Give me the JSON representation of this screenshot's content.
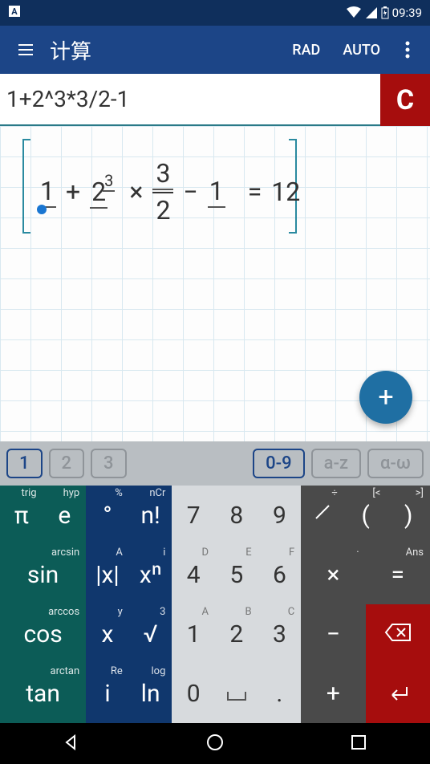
{
  "status": {
    "time": "09:39"
  },
  "appbar": {
    "title": "计算",
    "rad": "RAD",
    "auto": "AUTO"
  },
  "input": {
    "expression": "1+2^3*3/2-1",
    "clear": "C"
  },
  "preview": {
    "terms": {
      "t1": "1",
      "plus": "+",
      "base": "2",
      "exp": "3",
      "times": "×",
      "num": "3",
      "den": "2",
      "minus": "−",
      "t5": "1",
      "eq": "=",
      "res": "12"
    },
    "fab": "+"
  },
  "tabs": {
    "t1": "1",
    "t2": "2",
    "t3": "3",
    "num": "0-9",
    "az": "a-z",
    "greek": "α-ω"
  },
  "keys": {
    "r1": [
      {
        "m": "π",
        "h": [
          "trig"
        ],
        "cls": "c-teal one-hint"
      },
      {
        "m": "e",
        "h": [
          "hyp"
        ],
        "cls": "c-teal one-hint"
      },
      {
        "m": "°",
        "h": [
          "%"
        ],
        "cls": "c-blue one-hint"
      },
      {
        "m": "n!",
        "h": [
          "nCr"
        ],
        "cls": "c-blue one-hint"
      },
      {
        "m": "7",
        "h": [],
        "cls": "c-light"
      },
      {
        "m": "8",
        "h": [],
        "cls": "c-light"
      },
      {
        "m": "9",
        "h": [],
        "cls": "c-light"
      },
      {
        "m": "⁄",
        "h": [
          "÷"
        ],
        "cls": "c-dark one-hint"
      },
      {
        "m": "(",
        "h": [
          "[<"
        ],
        "cls": "c-dark one-hint"
      },
      {
        "m": ")",
        "h": [
          ">]"
        ],
        "cls": "c-dark one-hint"
      }
    ],
    "r2": [
      {
        "m": "sin",
        "h": [
          "arcsin"
        ],
        "cls": "c-teal one-hint"
      },
      {
        "m": "|x|",
        "h": [
          "A"
        ],
        "cls": "c-blue one-hint"
      },
      {
        "m": "xⁿ",
        "h": [
          "i"
        ],
        "cls": "c-blue one-hint"
      },
      {
        "m": "4",
        "h": [
          "D"
        ],
        "cls": "c-light one-hint"
      },
      {
        "m": "5",
        "h": [
          "E"
        ],
        "cls": "c-light one-hint"
      },
      {
        "m": "6",
        "h": [
          "F"
        ],
        "cls": "c-light one-hint"
      },
      {
        "m": "×",
        "h": [
          "·"
        ],
        "cls": "c-dark one-hint"
      },
      {
        "m": "=",
        "h": [
          "Ans"
        ],
        "cls": "c-dark one-hint"
      }
    ],
    "r3": [
      {
        "m": "cos",
        "h": [
          "arccos"
        ],
        "cls": "c-teal one-hint"
      },
      {
        "m": "x",
        "h": [
          "y"
        ],
        "cls": "c-blue one-hint"
      },
      {
        "m": "√",
        "h": [
          "3"
        ],
        "cls": "c-blue one-hint"
      },
      {
        "m": "1",
        "h": [
          "A"
        ],
        "cls": "c-light one-hint"
      },
      {
        "m": "2",
        "h": [
          "B"
        ],
        "cls": "c-light one-hint"
      },
      {
        "m": "3",
        "h": [
          "C"
        ],
        "cls": "c-light one-hint"
      },
      {
        "m": "−",
        "h": [],
        "cls": "c-dark"
      },
      {
        "m": "⌫",
        "h": [],
        "cls": "c-red"
      }
    ],
    "r4": [
      {
        "m": "tan",
        "h": [
          "arctan"
        ],
        "cls": "c-teal one-hint"
      },
      {
        "m": "i",
        "h": [
          "Re"
        ],
        "cls": "c-blue one-hint"
      },
      {
        "m": "ln",
        "h": [
          "log"
        ],
        "cls": "c-blue one-hint"
      },
      {
        "m": "0",
        "h": [],
        "cls": "c-light"
      },
      {
        "m": "␣",
        "h": [],
        "cls": "c-light"
      },
      {
        "m": ".",
        "h": [],
        "cls": "c-light"
      },
      {
        "m": "+",
        "h": [],
        "cls": "c-dark"
      },
      {
        "m": "↵",
        "h": [],
        "cls": "c-red"
      }
    ]
  }
}
